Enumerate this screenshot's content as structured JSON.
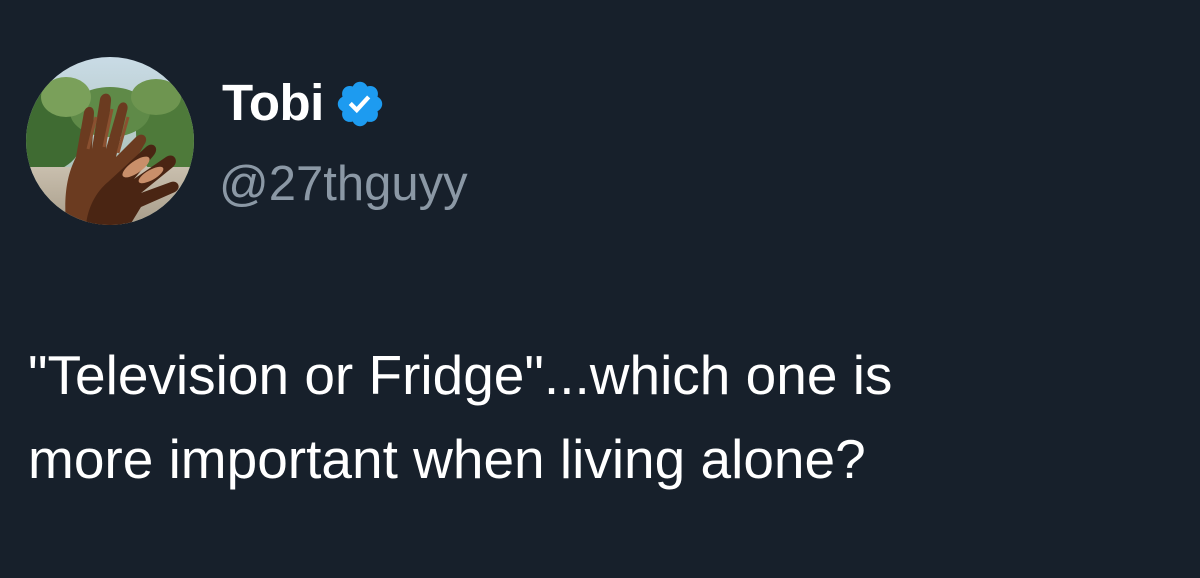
{
  "tweet": {
    "author": {
      "display_name": "Tobi",
      "handle": "@27thguyy",
      "verified_icon": "verified-badge-icon",
      "avatar_icon": "avatar-photo"
    },
    "text": "\"Television or Fridge\"...which one is\nmore important when living alone?"
  },
  "colors": {
    "background": "#17202b",
    "text_primary": "#ffffff",
    "text_secondary": "#8b98a5",
    "verified_blue": "#1d9bf0"
  }
}
